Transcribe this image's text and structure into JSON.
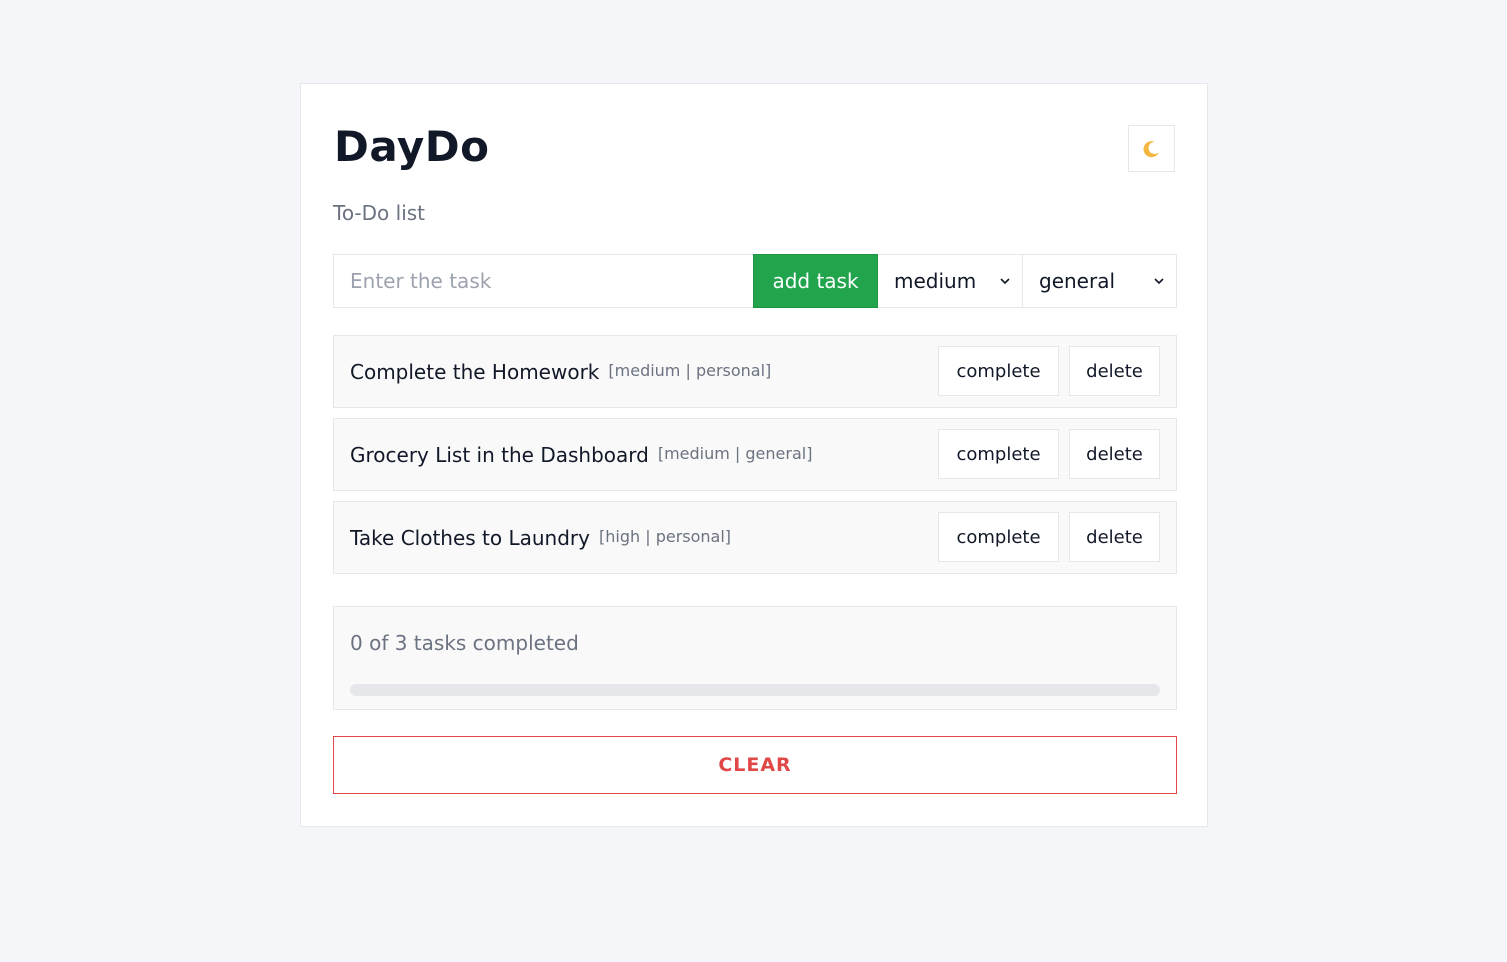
{
  "app": {
    "title": "DayDo",
    "subtitle": "To-Do list"
  },
  "theme_toggle": {
    "icon": "crescent-moon-icon"
  },
  "form": {
    "input_placeholder": "Enter the task",
    "input_value": "",
    "add_label": "add task",
    "priority_selected": "medium",
    "category_selected": "general"
  },
  "tasks": [
    {
      "name": "Complete the Homework",
      "meta": "[medium | personal]",
      "complete_label": "complete",
      "delete_label": "delete"
    },
    {
      "name": "Grocery List in the Dashboard",
      "meta": "[medium | general]",
      "complete_label": "complete",
      "delete_label": "delete"
    },
    {
      "name": "Take Clothes to Laundry",
      "meta": "[high | personal]",
      "complete_label": "complete",
      "delete_label": "delete"
    }
  ],
  "progress": {
    "text": "0 of 3 tasks completed",
    "completed": 0,
    "total": 3
  },
  "clear_label": "CLEAR",
  "colors": {
    "accent_green": "#22a44d",
    "danger_red": "#e04848",
    "background": "#f5f6fa"
  }
}
